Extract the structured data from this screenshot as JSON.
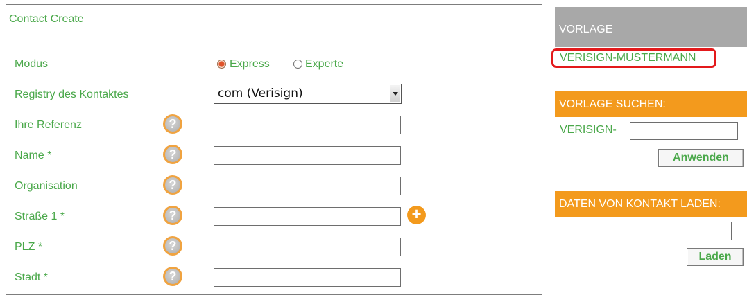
{
  "form": {
    "title": "Contact Create",
    "modus": {
      "label": "Modus",
      "options": [
        {
          "label": "Express",
          "selected": true
        },
        {
          "label": "Experte",
          "selected": false
        }
      ]
    },
    "registry": {
      "label": "Registry des Kontaktes",
      "selected": "com (Verisign)"
    },
    "fields": [
      {
        "label": "Ihre Referenz",
        "value": ""
      },
      {
        "label": "Name *",
        "value": ""
      },
      {
        "label": "Organisation",
        "value": ""
      },
      {
        "label": "Straße 1 *",
        "value": ""
      },
      {
        "label": "PLZ *",
        "value": ""
      },
      {
        "label": "Stadt *",
        "value": ""
      }
    ],
    "help_glyph": "?",
    "add_glyph": "+"
  },
  "sidebar": {
    "vorlage": {
      "header": "VORLAGE",
      "link": "VERISIGN-MUSTERMANN"
    },
    "suchen": {
      "header": "VORLAGE SUCHEN:",
      "prefix": "VERISIGN-",
      "input_value": "",
      "button": "Anwenden"
    },
    "laden": {
      "header": "DATEN VON KONTAKT LADEN:",
      "input_value": "",
      "button": "Laden"
    }
  },
  "colors": {
    "label_green": "#4aa84a",
    "accent_orange": "#f39a1d",
    "header_gray": "#a8a8a8",
    "highlight_red": "#e3191b"
  },
  "icons": [
    "help-icon",
    "plus-circle-icon",
    "dropdown-arrow-icon"
  ]
}
